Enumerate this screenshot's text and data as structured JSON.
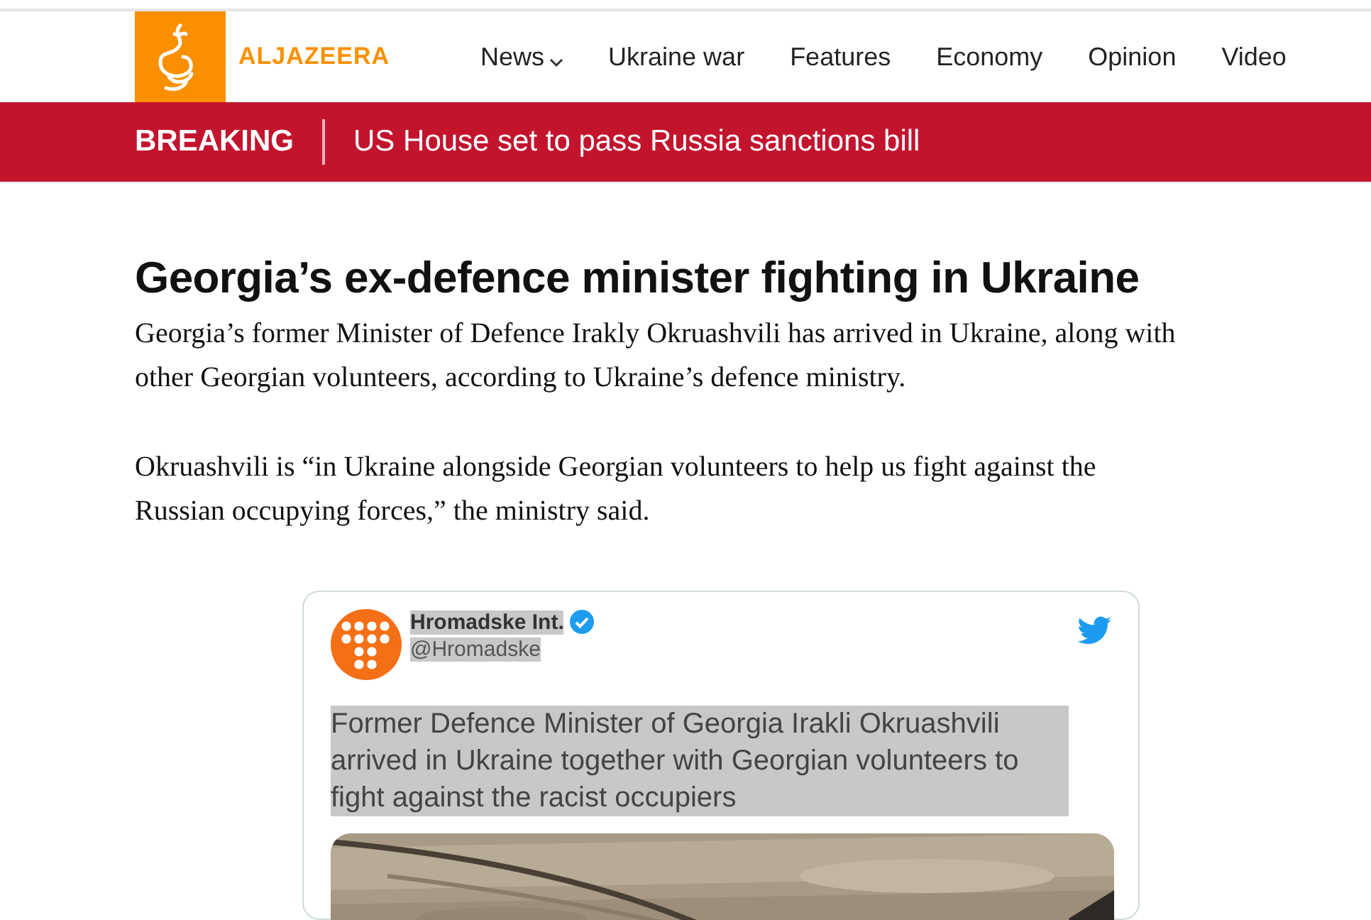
{
  "header": {
    "brand": "ALJAZEERA",
    "nav": [
      {
        "label": "News",
        "dropdown": true
      },
      {
        "label": "Ukraine war",
        "dropdown": false
      },
      {
        "label": "Features",
        "dropdown": false
      },
      {
        "label": "Economy",
        "dropdown": false
      },
      {
        "label": "Opinion",
        "dropdown": false
      },
      {
        "label": "Video",
        "dropdown": false
      }
    ]
  },
  "breaking": {
    "label": "BREAKING",
    "headline": "US House set to pass Russia sanctions bill"
  },
  "article": {
    "title": "Georgia’s ex-defence minister fighting in Ukraine",
    "paragraphs": [
      "Georgia’s former Minister of Defence Irakly Okruashvili has arrived in Ukraine, along with other Georgian volunteers, according to Ukraine’s defence ministry.",
      "Okruashvili is “in Ukraine alongside Georgian volunteers to help us fight against the Russian occupying forces,” the ministry said."
    ]
  },
  "tweet": {
    "author": "Hromadske Int.",
    "verified": true,
    "handle": "@Hromadske",
    "text": "Former Defence Minister of Georgia Irakli Okruashvili arrived in Ukraine together with Georgian volunteers to fight against the racist occupiers",
    "highlighted": true
  }
}
